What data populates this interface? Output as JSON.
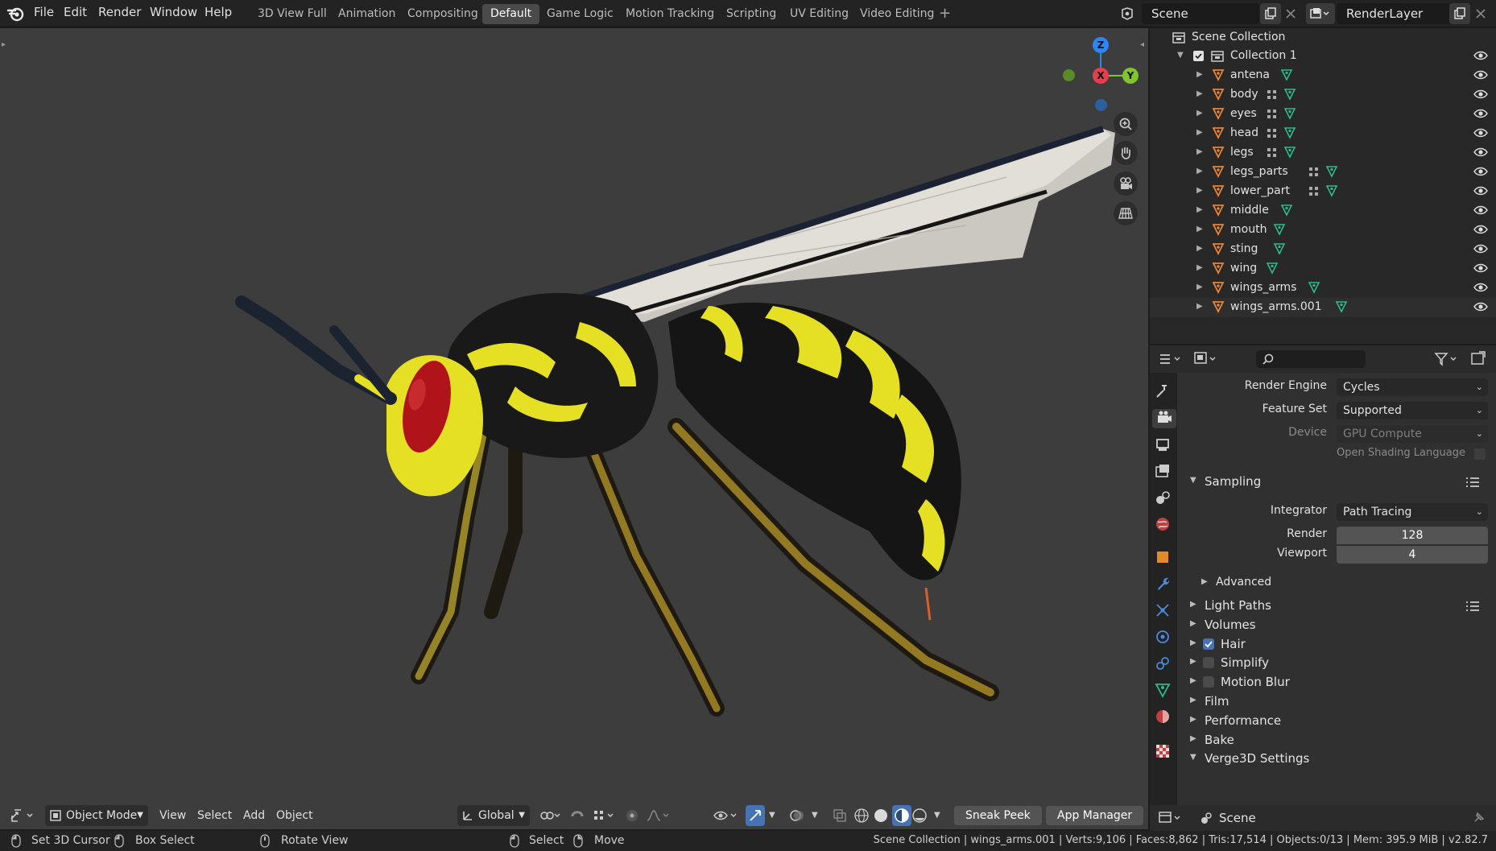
{
  "topbar": {
    "menus": [
      "File",
      "Edit",
      "Render",
      "Window",
      "Help"
    ],
    "workspaces": [
      "3D View Full",
      "Animation",
      "Compositing",
      "Default",
      "Game Logic",
      "Motion Tracking",
      "Scripting",
      "UV Editing",
      "Video Editing"
    ],
    "active_workspace": "Default",
    "add_workspace": "+",
    "scene": "Scene",
    "view_layer": "RenderLayer"
  },
  "viewport": {
    "background_color": "#3d3d3d",
    "gizmo": {
      "z": "Z",
      "x": "X",
      "y": "Y"
    },
    "header": {
      "mode": "Object Mode",
      "menus": [
        "View",
        "Select",
        "Add",
        "Object"
      ],
      "orientation": "Global",
      "sneak_peek": "Sneak Peek",
      "app_manager": "App Manager"
    }
  },
  "outliner": {
    "root": "Scene Collection",
    "collection": "Collection 1",
    "objects": [
      {
        "name": "antena",
        "modifier": false
      },
      {
        "name": "body",
        "modifier": true
      },
      {
        "name": "eyes",
        "modifier": true
      },
      {
        "name": "head",
        "modifier": true
      },
      {
        "name": "legs",
        "modifier": true
      },
      {
        "name": "legs_parts",
        "modifier": true
      },
      {
        "name": "lower_part",
        "modifier": true
      },
      {
        "name": "middle",
        "modifier": false
      },
      {
        "name": "mouth",
        "modifier": false
      },
      {
        "name": "sting",
        "modifier": false
      },
      {
        "name": "wing",
        "modifier": false
      },
      {
        "name": "wings_arms",
        "modifier": false
      },
      {
        "name": "wings_arms.001",
        "modifier": false
      }
    ]
  },
  "properties": {
    "search_placeholder": "",
    "render_engine_label": "Render Engine",
    "render_engine": "Cycles",
    "feature_set_label": "Feature Set",
    "feature_set": "Supported",
    "device_label": "Device",
    "device": "GPU Compute",
    "osl_label": "Open Shading Language",
    "sampling": {
      "title": "Sampling",
      "integrator_label": "Integrator",
      "integrator": "Path Tracing",
      "render_label": "Render",
      "render": "128",
      "viewport_label": "Viewport",
      "viewport": "4",
      "advanced": "Advanced"
    },
    "panels": [
      {
        "title": "Light Paths",
        "checkbox": null,
        "list_icon": true
      },
      {
        "title": "Volumes",
        "checkbox": null
      },
      {
        "title": "Hair",
        "checkbox": true
      },
      {
        "title": "Simplify",
        "checkbox": false
      },
      {
        "title": "Motion Blur",
        "checkbox": false
      },
      {
        "title": "Film",
        "checkbox": null
      },
      {
        "title": "Performance",
        "checkbox": null
      },
      {
        "title": "Bake",
        "checkbox": null
      },
      {
        "title": "Verge3D Settings",
        "checkbox": null,
        "expanded": true
      }
    ],
    "footer_scene": "Scene"
  },
  "statusbar": {
    "set_cursor": "Set 3D Cursor",
    "box_select": "Box Select",
    "rotate_view": "Rotate View",
    "select": "Select",
    "move": "Move",
    "info": "Scene Collection | wings_arms.001 | Verts:9,106 | Faces:8,862 | Tris:17,514 | Objects:0/13 | Mem: 395.9 MiB | v2.82.7"
  }
}
